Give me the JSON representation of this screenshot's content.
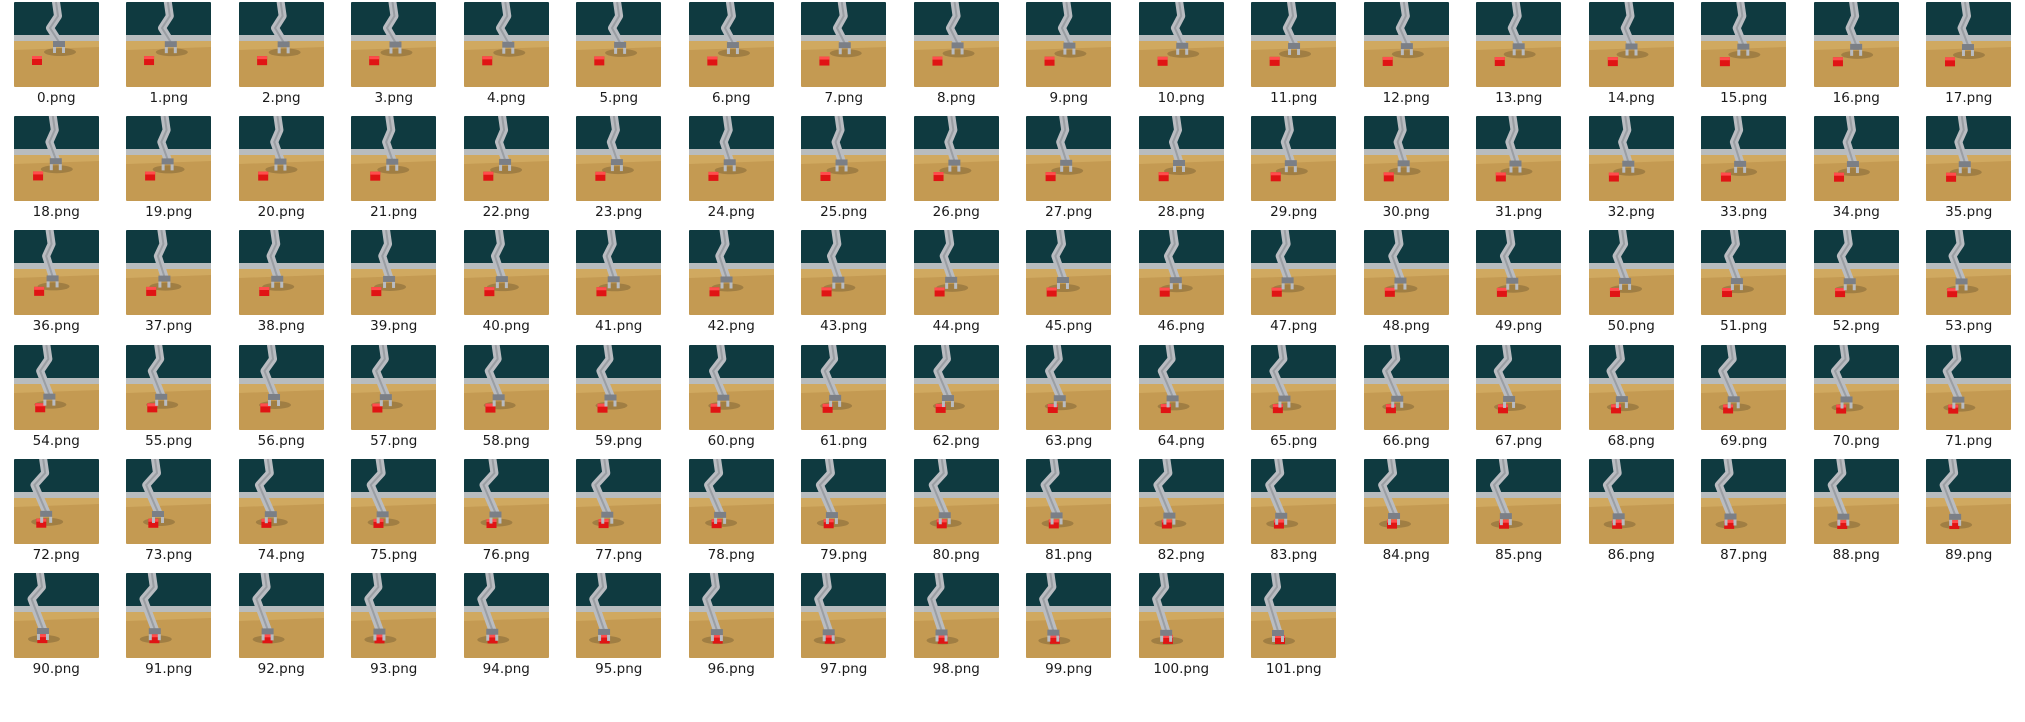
{
  "view": {
    "type": "icon-grid",
    "columns": 18
  },
  "colors": {
    "background": "#ffffff",
    "wall": "#0f3a40",
    "wall_band": "#b8bcbe",
    "table": "#c49a52",
    "table_light": "#d8b46a",
    "cube": "#e01414",
    "robot": "#b9bcc1",
    "robot_dark": "#7b7f86",
    "label": "#1a1a1a"
  },
  "files": [
    {
      "name": "0.png",
      "icon": "image-thumbnail"
    },
    {
      "name": "1.png",
      "icon": "image-thumbnail"
    },
    {
      "name": "2.png",
      "icon": "image-thumbnail"
    },
    {
      "name": "3.png",
      "icon": "image-thumbnail"
    },
    {
      "name": "4.png",
      "icon": "image-thumbnail"
    },
    {
      "name": "5.png",
      "icon": "image-thumbnail"
    },
    {
      "name": "6.png",
      "icon": "image-thumbnail"
    },
    {
      "name": "7.png",
      "icon": "image-thumbnail"
    },
    {
      "name": "8.png",
      "icon": "image-thumbnail"
    },
    {
      "name": "9.png",
      "icon": "image-thumbnail"
    },
    {
      "name": "10.png",
      "icon": "image-thumbnail"
    },
    {
      "name": "11.png",
      "icon": "image-thumbnail"
    },
    {
      "name": "12.png",
      "icon": "image-thumbnail"
    },
    {
      "name": "13.png",
      "icon": "image-thumbnail"
    },
    {
      "name": "14.png",
      "icon": "image-thumbnail"
    },
    {
      "name": "15.png",
      "icon": "image-thumbnail"
    },
    {
      "name": "16.png",
      "icon": "image-thumbnail"
    },
    {
      "name": "17.png",
      "icon": "image-thumbnail"
    },
    {
      "name": "18.png",
      "icon": "image-thumbnail"
    },
    {
      "name": "19.png",
      "icon": "image-thumbnail"
    },
    {
      "name": "20.png",
      "icon": "image-thumbnail"
    },
    {
      "name": "21.png",
      "icon": "image-thumbnail"
    },
    {
      "name": "22.png",
      "icon": "image-thumbnail"
    },
    {
      "name": "23.png",
      "icon": "image-thumbnail"
    },
    {
      "name": "24.png",
      "icon": "image-thumbnail"
    },
    {
      "name": "25.png",
      "icon": "image-thumbnail"
    },
    {
      "name": "26.png",
      "icon": "image-thumbnail"
    },
    {
      "name": "27.png",
      "icon": "image-thumbnail"
    },
    {
      "name": "28.png",
      "icon": "image-thumbnail"
    },
    {
      "name": "29.png",
      "icon": "image-thumbnail"
    },
    {
      "name": "30.png",
      "icon": "image-thumbnail"
    },
    {
      "name": "31.png",
      "icon": "image-thumbnail"
    },
    {
      "name": "32.png",
      "icon": "image-thumbnail"
    },
    {
      "name": "33.png",
      "icon": "image-thumbnail"
    },
    {
      "name": "34.png",
      "icon": "image-thumbnail"
    },
    {
      "name": "35.png",
      "icon": "image-thumbnail"
    },
    {
      "name": "36.png",
      "icon": "image-thumbnail"
    },
    {
      "name": "37.png",
      "icon": "image-thumbnail"
    },
    {
      "name": "38.png",
      "icon": "image-thumbnail"
    },
    {
      "name": "39.png",
      "icon": "image-thumbnail"
    },
    {
      "name": "40.png",
      "icon": "image-thumbnail"
    },
    {
      "name": "41.png",
      "icon": "image-thumbnail"
    },
    {
      "name": "42.png",
      "icon": "image-thumbnail"
    },
    {
      "name": "43.png",
      "icon": "image-thumbnail"
    },
    {
      "name": "44.png",
      "icon": "image-thumbnail"
    },
    {
      "name": "45.png",
      "icon": "image-thumbnail"
    },
    {
      "name": "46.png",
      "icon": "image-thumbnail"
    },
    {
      "name": "47.png",
      "icon": "image-thumbnail"
    },
    {
      "name": "48.png",
      "icon": "image-thumbnail"
    },
    {
      "name": "49.png",
      "icon": "image-thumbnail"
    },
    {
      "name": "50.png",
      "icon": "image-thumbnail"
    },
    {
      "name": "51.png",
      "icon": "image-thumbnail"
    },
    {
      "name": "52.png",
      "icon": "image-thumbnail"
    },
    {
      "name": "53.png",
      "icon": "image-thumbnail"
    },
    {
      "name": "54.png",
      "icon": "image-thumbnail"
    },
    {
      "name": "55.png",
      "icon": "image-thumbnail"
    },
    {
      "name": "56.png",
      "icon": "image-thumbnail"
    },
    {
      "name": "57.png",
      "icon": "image-thumbnail"
    },
    {
      "name": "58.png",
      "icon": "image-thumbnail"
    },
    {
      "name": "59.png",
      "icon": "image-thumbnail"
    },
    {
      "name": "60.png",
      "icon": "image-thumbnail"
    },
    {
      "name": "61.png",
      "icon": "image-thumbnail"
    },
    {
      "name": "62.png",
      "icon": "image-thumbnail"
    },
    {
      "name": "63.png",
      "icon": "image-thumbnail"
    },
    {
      "name": "64.png",
      "icon": "image-thumbnail"
    },
    {
      "name": "65.png",
      "icon": "image-thumbnail"
    },
    {
      "name": "66.png",
      "icon": "image-thumbnail"
    },
    {
      "name": "67.png",
      "icon": "image-thumbnail"
    },
    {
      "name": "68.png",
      "icon": "image-thumbnail"
    },
    {
      "name": "69.png",
      "icon": "image-thumbnail"
    },
    {
      "name": "70.png",
      "icon": "image-thumbnail"
    },
    {
      "name": "71.png",
      "icon": "image-thumbnail"
    },
    {
      "name": "72.png",
      "icon": "image-thumbnail"
    },
    {
      "name": "73.png",
      "icon": "image-thumbnail"
    },
    {
      "name": "74.png",
      "icon": "image-thumbnail"
    },
    {
      "name": "75.png",
      "icon": "image-thumbnail"
    },
    {
      "name": "76.png",
      "icon": "image-thumbnail"
    },
    {
      "name": "77.png",
      "icon": "image-thumbnail"
    },
    {
      "name": "78.png",
      "icon": "image-thumbnail"
    },
    {
      "name": "79.png",
      "icon": "image-thumbnail"
    },
    {
      "name": "80.png",
      "icon": "image-thumbnail"
    },
    {
      "name": "81.png",
      "icon": "image-thumbnail"
    },
    {
      "name": "82.png",
      "icon": "image-thumbnail"
    },
    {
      "name": "83.png",
      "icon": "image-thumbnail"
    },
    {
      "name": "84.png",
      "icon": "image-thumbnail"
    },
    {
      "name": "85.png",
      "icon": "image-thumbnail"
    },
    {
      "name": "86.png",
      "icon": "image-thumbnail"
    },
    {
      "name": "87.png",
      "icon": "image-thumbnail"
    },
    {
      "name": "88.png",
      "icon": "image-thumbnail"
    },
    {
      "name": "89.png",
      "icon": "image-thumbnail"
    },
    {
      "name": "90.png",
      "icon": "image-thumbnail"
    },
    {
      "name": "91.png",
      "icon": "image-thumbnail"
    },
    {
      "name": "92.png",
      "icon": "image-thumbnail"
    },
    {
      "name": "93.png",
      "icon": "image-thumbnail"
    },
    {
      "name": "94.png",
      "icon": "image-thumbnail"
    },
    {
      "name": "95.png",
      "icon": "image-thumbnail"
    },
    {
      "name": "96.png",
      "icon": "image-thumbnail"
    },
    {
      "name": "97.png",
      "icon": "image-thumbnail"
    },
    {
      "name": "98.png",
      "icon": "image-thumbnail"
    },
    {
      "name": "99.png",
      "icon": "image-thumbnail"
    },
    {
      "name": "100.png",
      "icon": "image-thumbnail"
    },
    {
      "name": "101.png",
      "icon": "image-thumbnail"
    }
  ]
}
